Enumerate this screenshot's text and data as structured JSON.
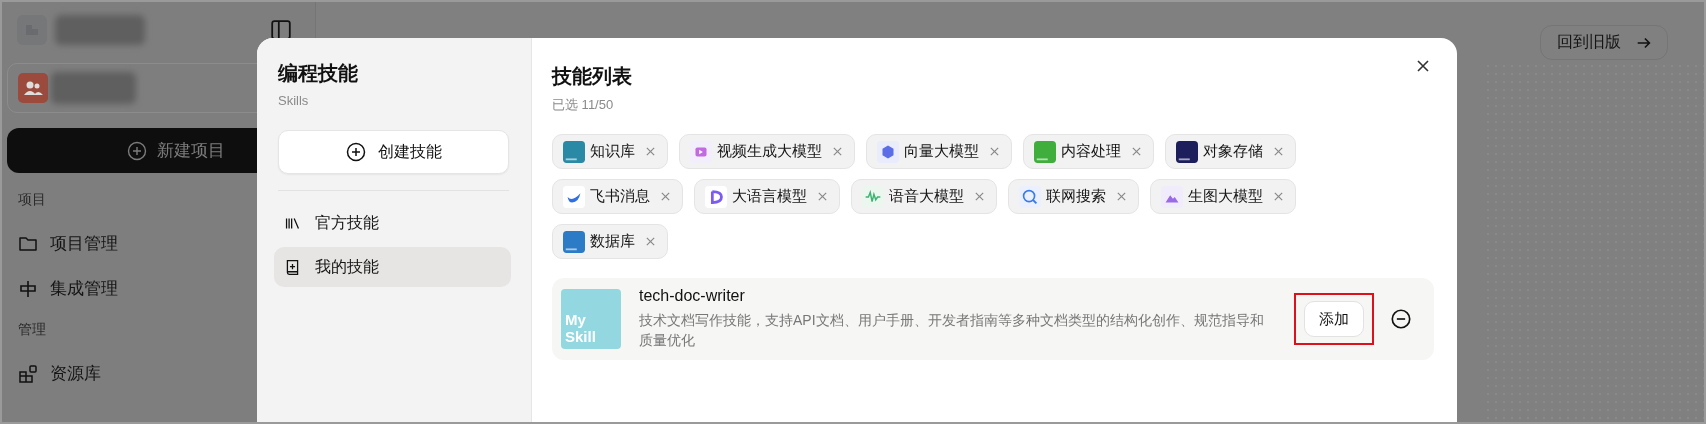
{
  "sidebar": {
    "new_project": "新建项目",
    "sections": [
      {
        "title": "项目",
        "items": [
          {
            "label": "项目管理"
          },
          {
            "label": "集成管理"
          }
        ]
      },
      {
        "title": "管理",
        "items": [
          {
            "label": "资源库"
          }
        ]
      }
    ]
  },
  "header": {
    "back_button": "回到旧版"
  },
  "dialog": {
    "title": "编程技能",
    "subtitle": "Skills",
    "create_button": "创建技能",
    "nav": [
      {
        "label": "官方技能",
        "selected": false
      },
      {
        "label": "我的技能",
        "selected": true
      }
    ],
    "list_title": "技能列表",
    "selected_count": "已选 11/50",
    "chips": [
      {
        "label": "知识库"
      },
      {
        "label": "视频生成大模型"
      },
      {
        "label": "向量大模型"
      },
      {
        "label": "内容处理"
      },
      {
        "label": "对象存储"
      },
      {
        "label": "飞书消息"
      },
      {
        "label": "大语言模型"
      },
      {
        "label": "语音大模型"
      },
      {
        "label": "联网搜索"
      },
      {
        "label": "生图大模型"
      },
      {
        "label": "数据库"
      }
    ],
    "skills": [
      {
        "name": "tech-doc-writer",
        "logo_text": "My Skill",
        "description": "技术文档写作技能，支持API文档、用户手册、开发者指南等多种文档类型的结构化创作、规范指导和质量优化",
        "add_button": "添加",
        "highlighted": true
      }
    ]
  }
}
